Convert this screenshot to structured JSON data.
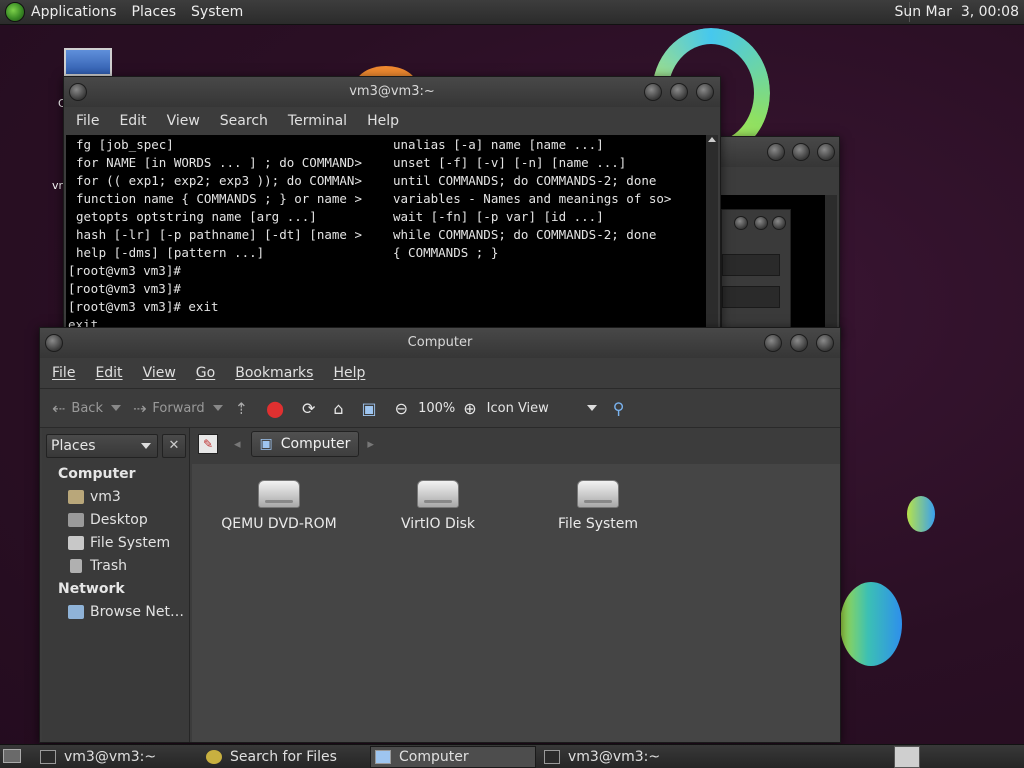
{
  "top_panel": {
    "menus": [
      "Applications",
      "Places",
      "System"
    ],
    "clock": "Sun Mar  3, 00:08"
  },
  "desktop": {
    "icon_labels": [
      "C",
      "vr"
    ]
  },
  "terminal_back": {
    "title": "vm3@vm3:~",
    "menu": [
      "File",
      "Edit",
      "View",
      "Search",
      "Terminal",
      "Help"
    ],
    "left_column": [
      "fg [job_spec]",
      "for NAME [in WORDS ... ] ; do COMMAND>",
      "for (( exp1; exp2; exp3 )); do COMMAN>",
      "function name { COMMANDS ; } or name >",
      "getopts optstring name [arg ...]",
      "hash [-lr] [-p pathname] [-dt] [name >",
      "help [-dms] [pattern ...]"
    ],
    "right_column": [
      "unalias [-a] name [name ...]",
      "unset [-f] [-v] [-n] [name ...]",
      "until COMMANDS; do COMMANDS-2; done",
      "variables - Names and meanings of so>",
      "wait [-fn] [-p var] [id ...]",
      "while COMMANDS; do COMMANDS-2; done",
      "{ COMMANDS ; }"
    ],
    "prompt_lines": [
      "[root@vm3 vm3]#",
      "[root@vm3 vm3]#",
      "[root@vm3 vm3]# exit",
      "exit"
    ]
  },
  "nautilus": {
    "title": "Computer",
    "menu": [
      "File",
      "Edit",
      "View",
      "Go",
      "Bookmarks",
      "Help"
    ],
    "toolbar": {
      "back": "Back",
      "forward": "Forward",
      "zoom": "100%",
      "view_mode": "Icon View"
    },
    "places_label": "Places",
    "close_glyph": "✕",
    "breadcrumb": "Computer",
    "sidebar": {
      "computer_heading": "Computer",
      "computer_items": [
        "vm3",
        "Desktop",
        "File System",
        "Trash"
      ],
      "network_heading": "Network",
      "network_items": [
        "Browse Net…"
      ]
    },
    "files": [
      "QEMU DVD-ROM",
      "VirtIO Disk",
      "File System"
    ]
  },
  "bottom_panel": {
    "tasks": [
      "vm3@vm3:~",
      "Search for Files",
      "Computer",
      "vm3@vm3:~"
    ]
  },
  "colors": {
    "desktop_bg": "#2a0f24",
    "panel_bg": "#2b2b2b",
    "window_bg": "#3c3c3c",
    "terminal_bg": "#000000"
  }
}
